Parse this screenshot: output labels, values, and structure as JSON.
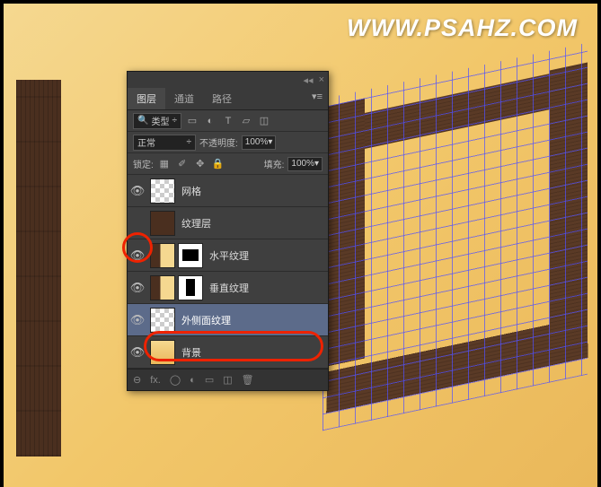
{
  "watermark": "WWW.PSAHZ.COM",
  "panel": {
    "tabs": {
      "layers": "图层",
      "channels": "通道",
      "paths": "路径"
    },
    "filter": {
      "kind": "类型"
    },
    "icons": {
      "image": "▭",
      "adjust": "◐",
      "text": "T",
      "shape": "▱",
      "smart": "◫"
    },
    "blend": {
      "mode": "正常",
      "opacityLabel": "不透明度:",
      "opacity": "100%"
    },
    "lock": {
      "label": "锁定:",
      "fillLabel": "填充:",
      "fill": "100%"
    },
    "lockIcons": {
      "trans": "▦",
      "paint": "✐",
      "move": "✥",
      "all": "🔒"
    },
    "layers": [
      {
        "name": "网格",
        "thumb": "checker",
        "visible": true,
        "mask": null
      },
      {
        "name": "纹理层",
        "thumb": "wood",
        "visible": false,
        "mask": null
      },
      {
        "name": "水平纹理",
        "thumb": "woodsm",
        "visible": true,
        "mask": "h"
      },
      {
        "name": "垂直纹理",
        "thumb": "woodsm",
        "visible": true,
        "mask": "v"
      },
      {
        "name": "外侧面纹理",
        "thumb": "checker",
        "visible": true,
        "mask": null,
        "selected": true
      },
      {
        "name": "背景",
        "thumb": "grad",
        "visible": true,
        "mask": null
      }
    ],
    "footer": {
      "link": "⊖",
      "fx": "fx.",
      "mask": "◯",
      "adjust": "◐",
      "group": "▭",
      "new": "◫",
      "trash": "🗑"
    }
  }
}
